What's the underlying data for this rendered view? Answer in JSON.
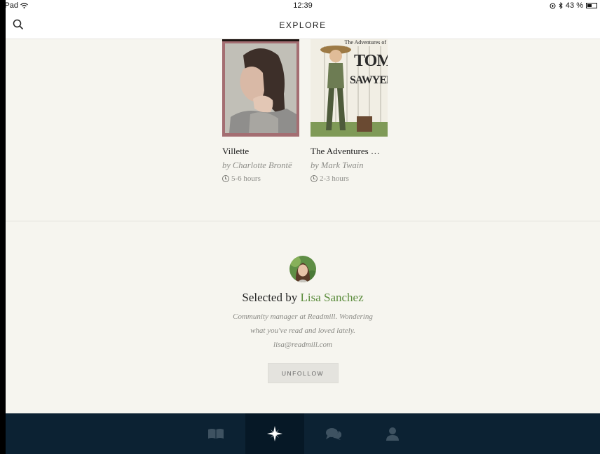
{
  "status_bar": {
    "left": "iPad",
    "time": "12:39",
    "battery": "43 %"
  },
  "nav": {
    "title": "EXPLORE"
  },
  "books": [
    {
      "title": "Villette",
      "author": "by Charlotte Brontë",
      "duration": "5-6 hours"
    },
    {
      "title": "The Adventures …",
      "author": "by Mark Twain",
      "duration": "2-3 hours",
      "cover_caption": "The Adventures of",
      "cover_title_1": "TOM",
      "cover_title_2": "SAWYER"
    }
  ],
  "curator": {
    "prefix": "Selected by ",
    "name": "Lisa Sanchez",
    "bio": "Community manager at Readmill. Wondering what you've read and loved lately. lisa@readmill.com",
    "button": "UNFOLLOW"
  },
  "tabs": [
    {
      "icon": "book-icon",
      "active": false
    },
    {
      "icon": "compass-star-icon",
      "active": true
    },
    {
      "icon": "chat-icon",
      "active": false
    },
    {
      "icon": "user-icon",
      "active": false
    }
  ],
  "colors": {
    "accent": "#5b8c3c",
    "tabbar": "#0c2233",
    "background": "#f6f5ef"
  }
}
